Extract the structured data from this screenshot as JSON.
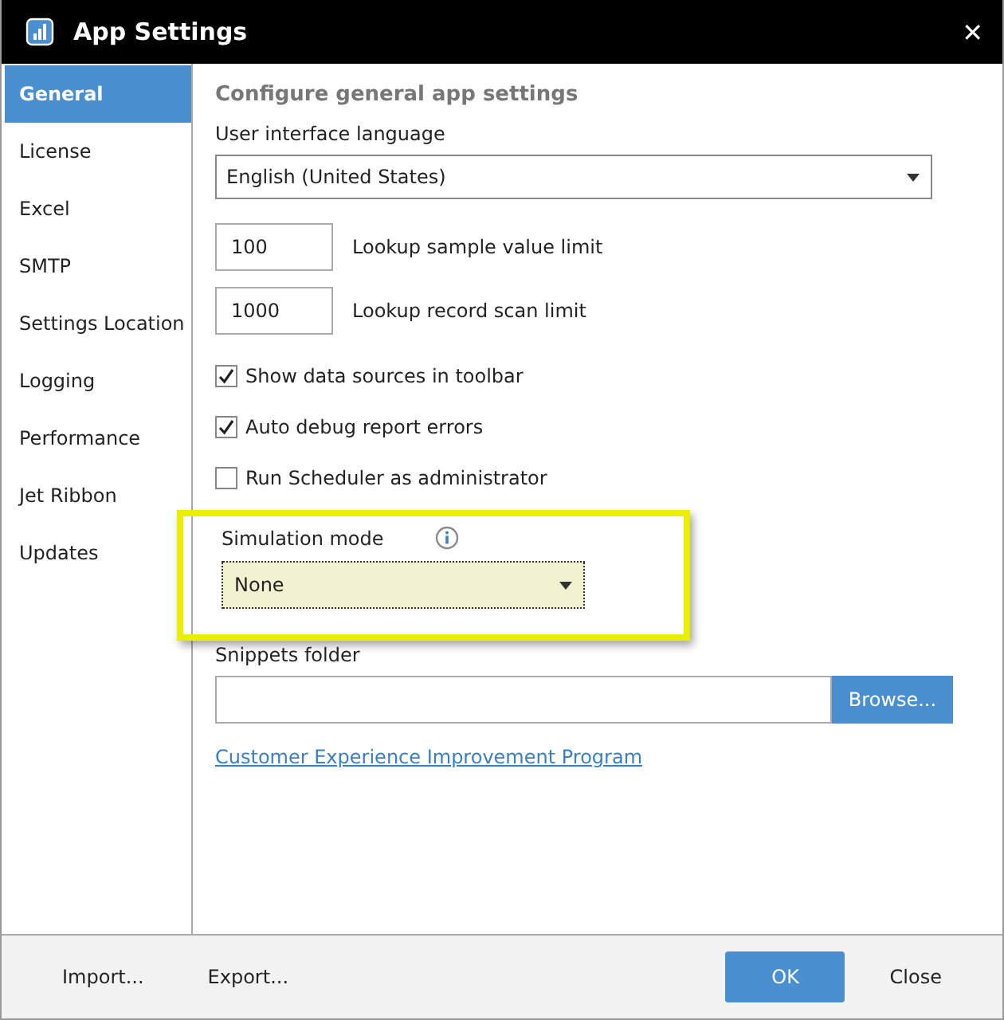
{
  "window": {
    "title": "App Settings",
    "close": "✕"
  },
  "sidebar": {
    "items": [
      {
        "label": "General",
        "selected": true
      },
      {
        "label": "License",
        "selected": false
      },
      {
        "label": "Excel",
        "selected": false
      },
      {
        "label": "SMTP",
        "selected": false
      },
      {
        "label": "Settings Location",
        "selected": false
      },
      {
        "label": "Logging",
        "selected": false
      },
      {
        "label": "Performance",
        "selected": false
      },
      {
        "label": "Jet Ribbon",
        "selected": false
      },
      {
        "label": "Updates",
        "selected": false
      }
    ]
  },
  "content": {
    "heading": "Configure general app settings",
    "language": {
      "label": "User interface language",
      "value": "English (United States)"
    },
    "limits": [
      {
        "value": "100",
        "label": "Lookup sample value limit"
      },
      {
        "value": "1000",
        "label": "Lookup record scan limit"
      }
    ],
    "checkboxes": [
      {
        "label": "Show data sources in toolbar",
        "checked": true
      },
      {
        "label": "Auto debug report errors",
        "checked": true
      },
      {
        "label": "Run Scheduler as administrator",
        "checked": false
      }
    ],
    "simulation": {
      "label": "Simulation mode",
      "value": "None",
      "highlighted": true
    },
    "snippets": {
      "label": "Snippets folder",
      "button": "Browse..."
    },
    "link": "Customer Experience Improvement Program"
  },
  "footer": {
    "left": [
      "Import...",
      "Export..."
    ],
    "ok": "OK",
    "close": "Close"
  }
}
